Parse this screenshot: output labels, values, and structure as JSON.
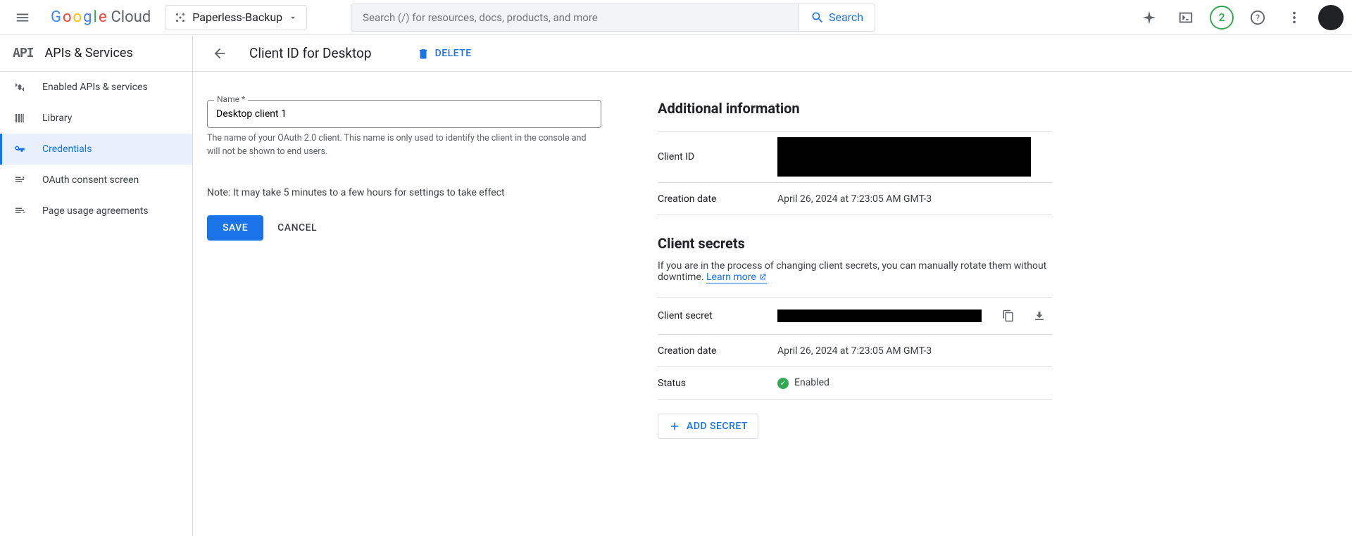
{
  "topbar": {
    "project_name": "Paperless-Backup",
    "search_placeholder": "Search (/) for resources, docs, products, and more",
    "search_button": "Search",
    "notification_count": "2"
  },
  "sidebar": {
    "product_badge": "API",
    "product_title": "APIs & Services",
    "items": [
      {
        "label": "Enabled APIs & services"
      },
      {
        "label": "Library"
      },
      {
        "label": "Credentials"
      },
      {
        "label": "OAuth consent screen"
      },
      {
        "label": "Page usage agreements"
      }
    ]
  },
  "page": {
    "title": "Client ID for Desktop",
    "delete_label": "DELETE"
  },
  "form": {
    "name_label": "Name *",
    "name_value": "Desktop client 1",
    "name_help": "The name of your OAuth 2.0 client. This name is only used to identify the client in the console and will not be shown to end users.",
    "note": "Note: It may take 5 minutes to a few hours for settings to take effect",
    "save_label": "SAVE",
    "cancel_label": "CANCEL"
  },
  "info": {
    "heading": "Additional information",
    "client_id_label": "Client ID",
    "creation_date_label": "Creation date",
    "creation_date_value": "April 26, 2024 at 7:23:05 AM GMT-3"
  },
  "secrets": {
    "heading": "Client secrets",
    "description": "If you are in the process of changing client secrets, you can manually rotate them without downtime. ",
    "learn_more": "Learn more",
    "client_secret_label": "Client secret",
    "creation_date_label": "Creation date",
    "creation_date_value": "April 26, 2024 at 7:23:05 AM GMT-3",
    "status_label": "Status",
    "status_value": "Enabled",
    "add_secret_label": "ADD SECRET"
  }
}
